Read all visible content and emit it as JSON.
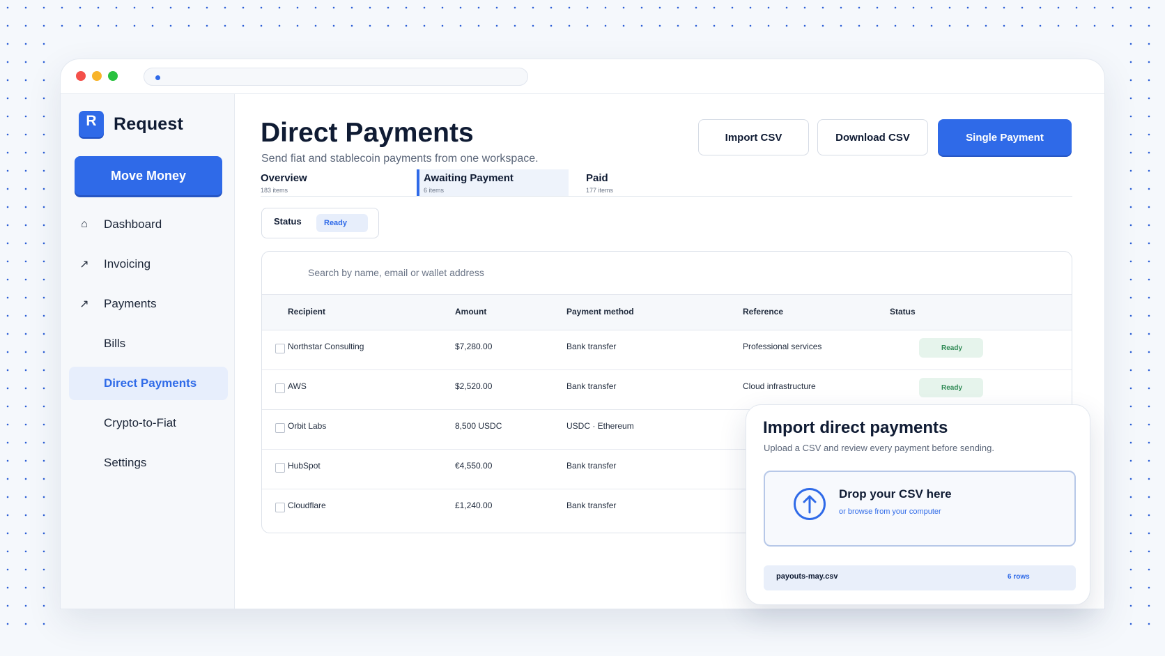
{
  "app": {
    "name": "Request",
    "logo_letter": "R",
    "accent_color": "#2f6ae8",
    "ready_color": "#2f8a55"
  },
  "sidebar": {
    "primary_action": "Move Money",
    "items": [
      {
        "label": "Dashboard",
        "icon": "home-icon",
        "glyph": "⌂",
        "active": false
      },
      {
        "label": "Invoicing",
        "icon": "arrow-up-right-icon",
        "glyph": "↗",
        "active": false
      },
      {
        "label": "Payments",
        "icon": "arrow-up-right-icon",
        "glyph": "↗",
        "active": false
      },
      {
        "label": "Bills",
        "icon": "",
        "glyph": "",
        "active": false
      },
      {
        "label": "Direct Payments",
        "icon": "",
        "glyph": "",
        "active": true
      },
      {
        "label": "Crypto-to-Fiat",
        "icon": "",
        "glyph": "",
        "active": false
      },
      {
        "label": "Settings",
        "icon": "",
        "glyph": "",
        "active": false
      }
    ]
  },
  "header": {
    "title": "Direct Payments",
    "subtitle": "Send fiat and stablecoin payments from one workspace.",
    "import_label": "Import CSV",
    "download_label": "Download CSV",
    "single_payment_label": "Single Payment"
  },
  "tabs": [
    {
      "label": "Overview",
      "count": "183 items",
      "active": false
    },
    {
      "label": "Awaiting Payment",
      "count": "6 items",
      "active": true
    },
    {
      "label": "Paid",
      "count": "177 items",
      "active": false
    }
  ],
  "filter": {
    "label": "Status",
    "value": "Ready"
  },
  "search": {
    "placeholder": "Search by name, email or wallet address"
  },
  "table": {
    "columns": [
      "Recipient",
      "Amount",
      "Payment method",
      "Reference",
      "Status"
    ],
    "rows": [
      {
        "recipient": "Northstar Consulting",
        "amount": "$7,280.00",
        "method": "Bank transfer",
        "reference": "Professional services",
        "status": "Ready"
      },
      {
        "recipient": "AWS",
        "amount": "$2,520.00",
        "method": "Bank transfer",
        "reference": "Cloud infrastructure",
        "status": "Ready"
      },
      {
        "recipient": "Orbit Labs",
        "amount": "8,500 USDC",
        "method": "USDC · Ethereum",
        "reference": "",
        "status": ""
      },
      {
        "recipient": "HubSpot",
        "amount": "€4,550.00",
        "method": "Bank transfer",
        "reference": "",
        "status": ""
      },
      {
        "recipient": "Cloudflare",
        "amount": "£1,240.00",
        "method": "Bank transfer",
        "reference": "",
        "status": ""
      }
    ]
  },
  "modal": {
    "title": "Import direct payments",
    "subtitle": "Upload a CSV and review every payment before sending.",
    "drop_title": "Drop your CSV here",
    "drop_link": "or browse from your computer",
    "file_name": "payouts-may.csv",
    "file_rows": "6 rows"
  }
}
